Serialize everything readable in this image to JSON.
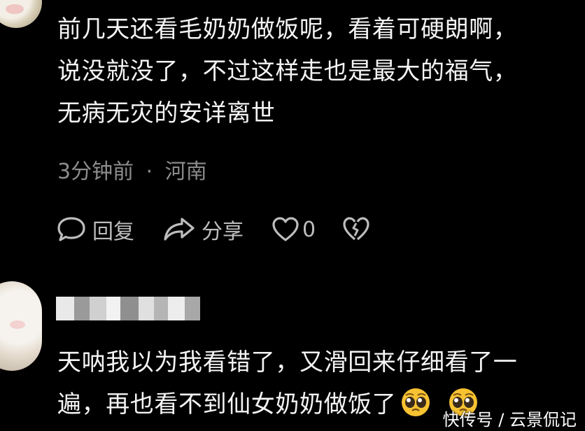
{
  "comment1": {
    "lines": [
      "前几天还看毛奶奶做饭呢，看着可硬朗啊，",
      "说没就没了，不过这样走也是最大的福气，",
      "无病无灾的安详离世"
    ],
    "time": "3分钟前",
    "separator": "·",
    "location": "河南",
    "actions": {
      "reply_label": "回复",
      "share_label": "分享",
      "like_count": "0"
    }
  },
  "comment2": {
    "lines": [
      "天呐我以为我看错了，又滑回来仔细看了一",
      "遍，再也看不到仙女奶奶做饭了"
    ],
    "emojis": [
      "pleading-face-icon",
      "pleading-face-icon"
    ]
  },
  "watermark": "快传号 / 云景侃记",
  "colors": {
    "background": "#000000",
    "text": "#f4f4f4",
    "meta": "#8c8c8c",
    "icon": "#bdbdbd"
  }
}
